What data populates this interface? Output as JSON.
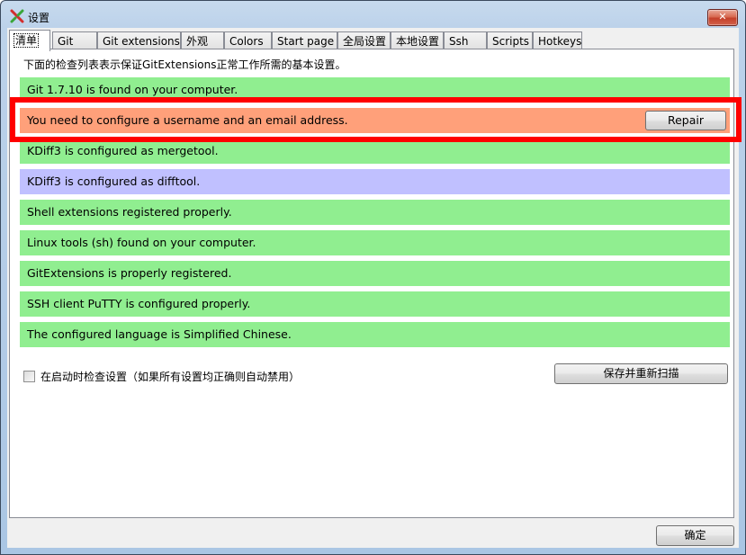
{
  "window": {
    "title": "设置",
    "app_icon": "git-extensions-logo-icon",
    "close_glyph": "✕"
  },
  "tabs": [
    {
      "label": "清单",
      "active": true
    },
    {
      "label": "Git",
      "active": false
    },
    {
      "label": "Git extensions",
      "active": false
    },
    {
      "label": "外观",
      "active": false
    },
    {
      "label": "Colors",
      "active": false
    },
    {
      "label": "Start page",
      "active": false
    },
    {
      "label": "全局设置",
      "active": false
    },
    {
      "label": "本地设置",
      "active": false
    },
    {
      "label": "Ssh",
      "active": false
    },
    {
      "label": "Scripts",
      "active": false
    },
    {
      "label": "Hotkeys",
      "active": false
    }
  ],
  "checklist": {
    "intro": "下面的检查列表表示保证GitExtensions正常工作所需的基本设置。",
    "items": [
      {
        "text": "Git 1.7.10 is found on your computer.",
        "status": "ok",
        "color": "#90ee90"
      },
      {
        "text": "You need to configure a username and an email address.",
        "status": "error",
        "color": "#ffa07a",
        "action": "Repair"
      },
      {
        "text": "KDiff3 is configured as mergetool.",
        "status": "ok",
        "color": "#90ee90"
      },
      {
        "text": "KDiff3 is configured as difftool.",
        "status": "info",
        "color": "#c0c0ff"
      },
      {
        "text": "Shell extensions registered properly.",
        "status": "ok",
        "color": "#90ee90"
      },
      {
        "text": "Linux tools (sh) found on your computer.",
        "status": "ok",
        "color": "#90ee90"
      },
      {
        "text": "GitExtensions is properly registered.",
        "status": "ok",
        "color": "#90ee90"
      },
      {
        "text": "SSH client PuTTY is configured properly.",
        "status": "ok",
        "color": "#90ee90"
      },
      {
        "text": "The configured language is Simplified Chinese.",
        "status": "ok",
        "color": "#90ee90"
      }
    ],
    "check_on_startup_label": "在启动时检查设置（如果所有设置均正确则自动禁用）",
    "check_on_startup_checked": false,
    "save_rescan_label": "保存并重新扫描"
  },
  "footer": {
    "ok_label": "确定"
  },
  "annotation": {
    "highlight_color": "#ff0000"
  }
}
